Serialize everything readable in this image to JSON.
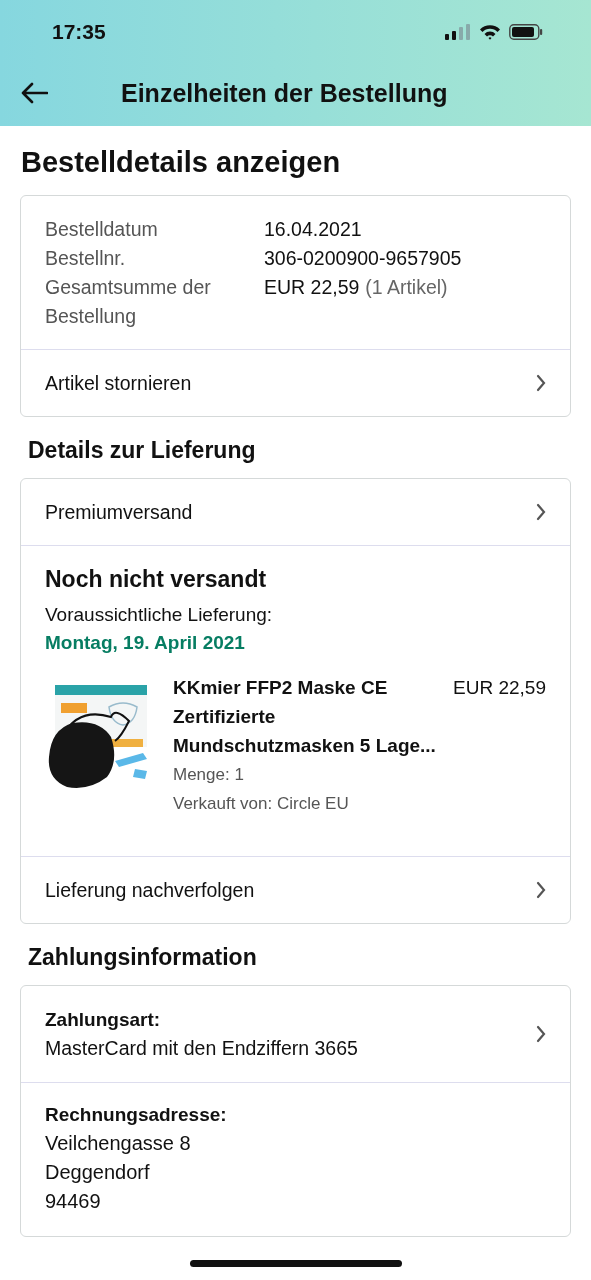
{
  "status_bar": {
    "time": "17:35"
  },
  "nav": {
    "title": "Einzelheiten der Bestellung"
  },
  "page_title": "Bestelldetails anzeigen",
  "order_summary": {
    "fields": [
      {
        "label": "Bestelldatum",
        "value": "16.04.2021"
      },
      {
        "label": "Bestellnr.",
        "value": "306-0200900-9657905"
      },
      {
        "label": "Gesamtsumme der Bestellung",
        "value": "EUR 22,59",
        "note": "(1 Artikel)"
      }
    ],
    "action": "Artikel stornieren"
  },
  "delivery": {
    "heading": "Details zur Lieferung",
    "shipping": "Premiumversand",
    "status": "Noch nicht versandt",
    "estimate_label": "Voraussichtliche Lieferung:",
    "estimate_date": "Montag, 19. April 2021",
    "item": {
      "title": "KKmier FFP2 Maske CE Zertifizierte Mundschutzmasken 5 Lage...",
      "price": "EUR 22,59",
      "quantity": "Menge: 1",
      "seller": "Verkauft von: Circle EU"
    },
    "action": "Lieferung nachverfolgen"
  },
  "payment": {
    "heading": "Zahlungsinformation",
    "method_label": "Zahlungsart:",
    "method": "MasterCard mit den Endziffern 3665",
    "address_label": "Rechnungsadresse:",
    "address_lines": [
      "Veilchengasse 8",
      "Deggendorf",
      "94469"
    ]
  }
}
